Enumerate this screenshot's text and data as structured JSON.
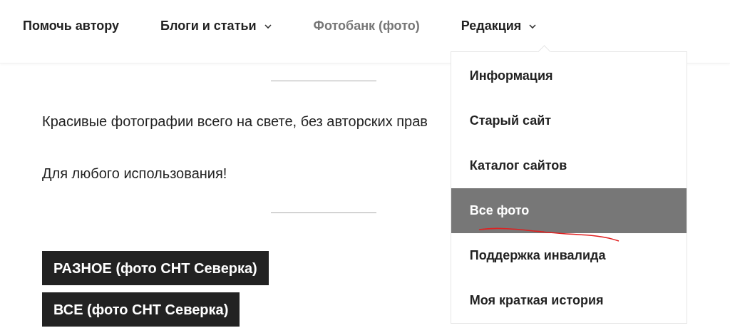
{
  "nav": {
    "items": [
      {
        "label": "Помочь автору",
        "selected": false,
        "has_dropdown": false
      },
      {
        "label": "Блоги и статьи",
        "selected": false,
        "has_dropdown": true,
        "expanded": false
      },
      {
        "label": "Фотобанк (фото)",
        "selected": true,
        "has_dropdown": false
      },
      {
        "label": "Редакция",
        "selected": false,
        "has_dropdown": true,
        "expanded": true
      }
    ]
  },
  "dropdown": {
    "items": [
      {
        "label": "Информация",
        "selected": false
      },
      {
        "label": "Старый сайт",
        "selected": false
      },
      {
        "label": "Каталог сайтов",
        "selected": false
      },
      {
        "label": "Все фото",
        "selected": true
      },
      {
        "label": "Поддержка инвалида",
        "selected": false
      },
      {
        "label": "Моя краткая история",
        "selected": false
      }
    ]
  },
  "content": {
    "paragraphs": [
      "Красивые фотографии всего на свете, без авторских прав",
      "Для любого использования!"
    ],
    "buttons": [
      "РАЗНОЕ (фото СНТ Северка)",
      "ВСЕ (фото СНТ Северка)"
    ]
  }
}
